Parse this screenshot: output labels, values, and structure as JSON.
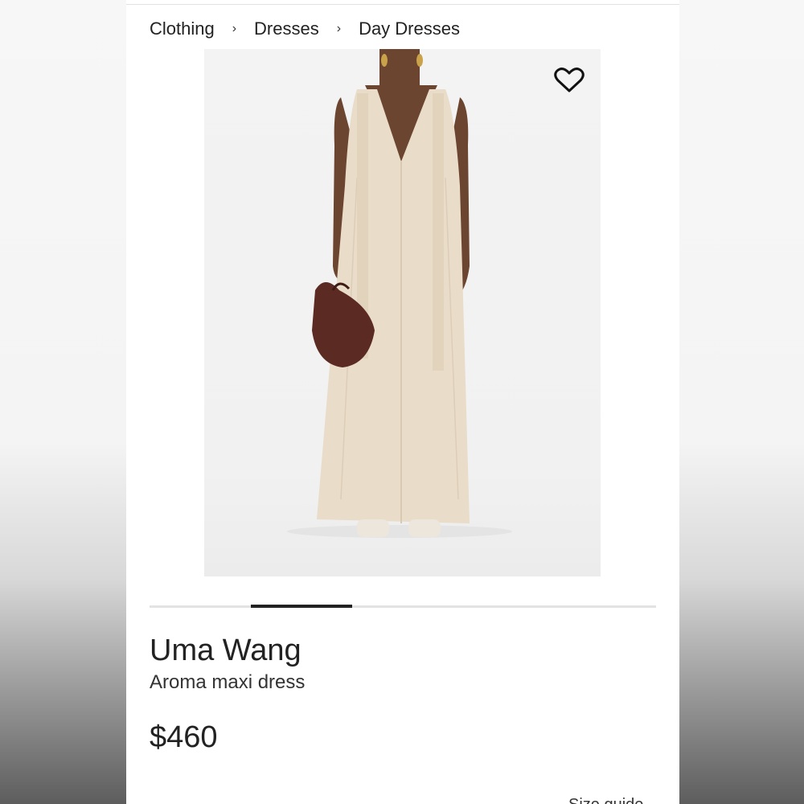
{
  "breadcrumb": {
    "items": [
      {
        "label": "Clothing"
      },
      {
        "label": "Dresses"
      },
      {
        "label": "Day Dresses"
      }
    ],
    "separator": "›"
  },
  "product": {
    "brand": "Uma Wang",
    "name": "Aroma maxi dress",
    "price": "$460",
    "image": {
      "wishlist_icon": "heart-icon",
      "carousel_active_index": 1,
      "carousel_total": 5
    }
  },
  "footer": {
    "size_guide_label": "Size guide"
  },
  "colors": {
    "dress": "#e9dcc9",
    "bag": "#5b2a22",
    "skin": "#6b4530",
    "image_bg": "#f2f2f2",
    "text": "#222222"
  }
}
